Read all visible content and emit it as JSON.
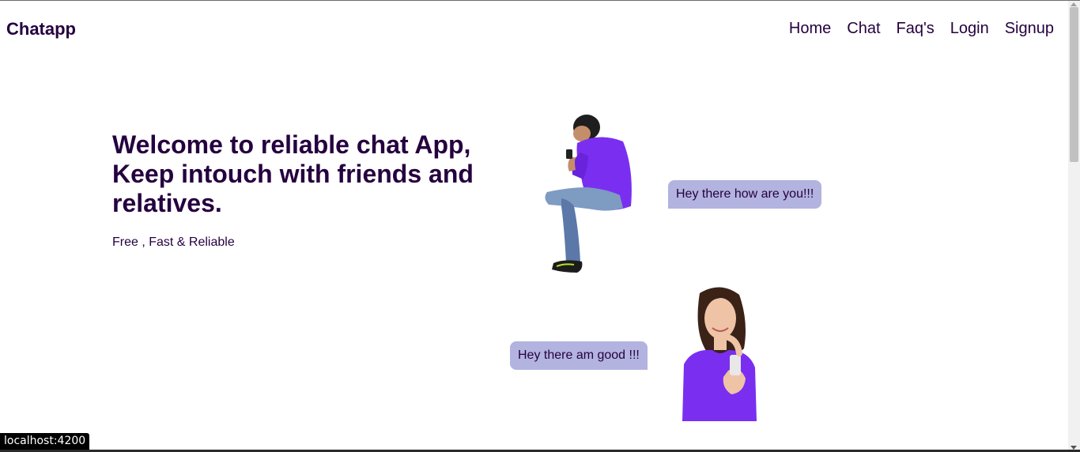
{
  "brand": "Chatapp",
  "nav": {
    "items": [
      {
        "label": "Home"
      },
      {
        "label": "Chat"
      },
      {
        "label": "Faq's"
      },
      {
        "label": "Login"
      },
      {
        "label": "Signup"
      }
    ]
  },
  "hero": {
    "title": "Welcome to reliable chat App, Keep intouch with friends and relatives.",
    "subtitle": "Free , Fast & Reliable"
  },
  "chat": {
    "message_1": "Hey there how are you!!!",
    "message_2": "Hey there am good !!!"
  },
  "status_bar": {
    "url": "localhost:4200"
  },
  "colors": {
    "primary_text": "#25003f",
    "bubble": "#b2b3df",
    "shirt": "#7a2ff0"
  }
}
